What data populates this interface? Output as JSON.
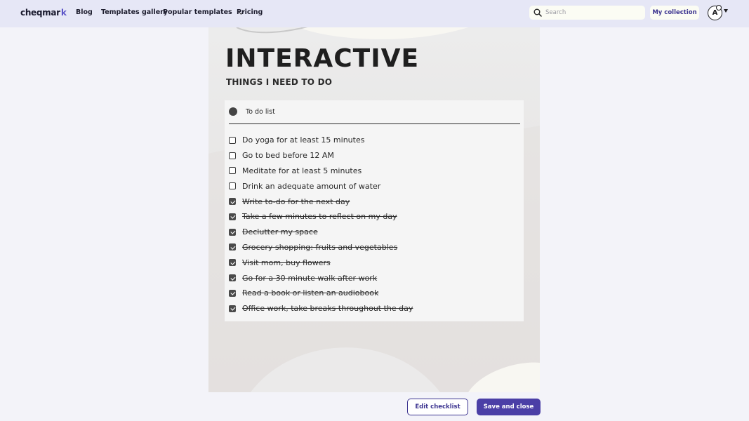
{
  "nav": {
    "logo_text": "cheqmar",
    "logo_mark": "k",
    "links": {
      "blog": "Blog",
      "templates": "Templates gallery",
      "popular": "Popular templates",
      "pricing": "Pricing"
    },
    "search_placeholder": "Search",
    "my_collection": "My collection",
    "avatar_initial": "A"
  },
  "document": {
    "title": "INTERACTIVE",
    "subtitle": "THINGS I NEED TO DO",
    "list_title": "To do list",
    "items": [
      {
        "label": "Do yoga for at least 15 minutes",
        "checked": false
      },
      {
        "label": "Go to bed before 12 AM",
        "checked": false
      },
      {
        "label": "Meditate for at least 5 minutes",
        "checked": false
      },
      {
        "label": "Drink an adequate amount of water",
        "checked": false
      },
      {
        "label": "Write to-do for the next day",
        "checked": true
      },
      {
        "label": "Take a few minutes to reflect on my day",
        "checked": true
      },
      {
        "label": "Declutter my space",
        "checked": true
      },
      {
        "label": "Grocery shopping: fruits and vegetables",
        "checked": true
      },
      {
        "label": "Visit mom, buy flowers",
        "checked": true
      },
      {
        "label": "Go for a 30 minute walk after work",
        "checked": true
      },
      {
        "label": "Read a book or listen an audiobook",
        "checked": true
      },
      {
        "label": "Office work, take breaks throughout the day",
        "checked": true
      }
    ]
  },
  "actions": {
    "edit": "Edit checklist",
    "save": "Save and close"
  },
  "colors": {
    "accent": "#4b3fa6",
    "nav_bg": "#e6e7f6",
    "page_bg": "#f3f3f9"
  }
}
